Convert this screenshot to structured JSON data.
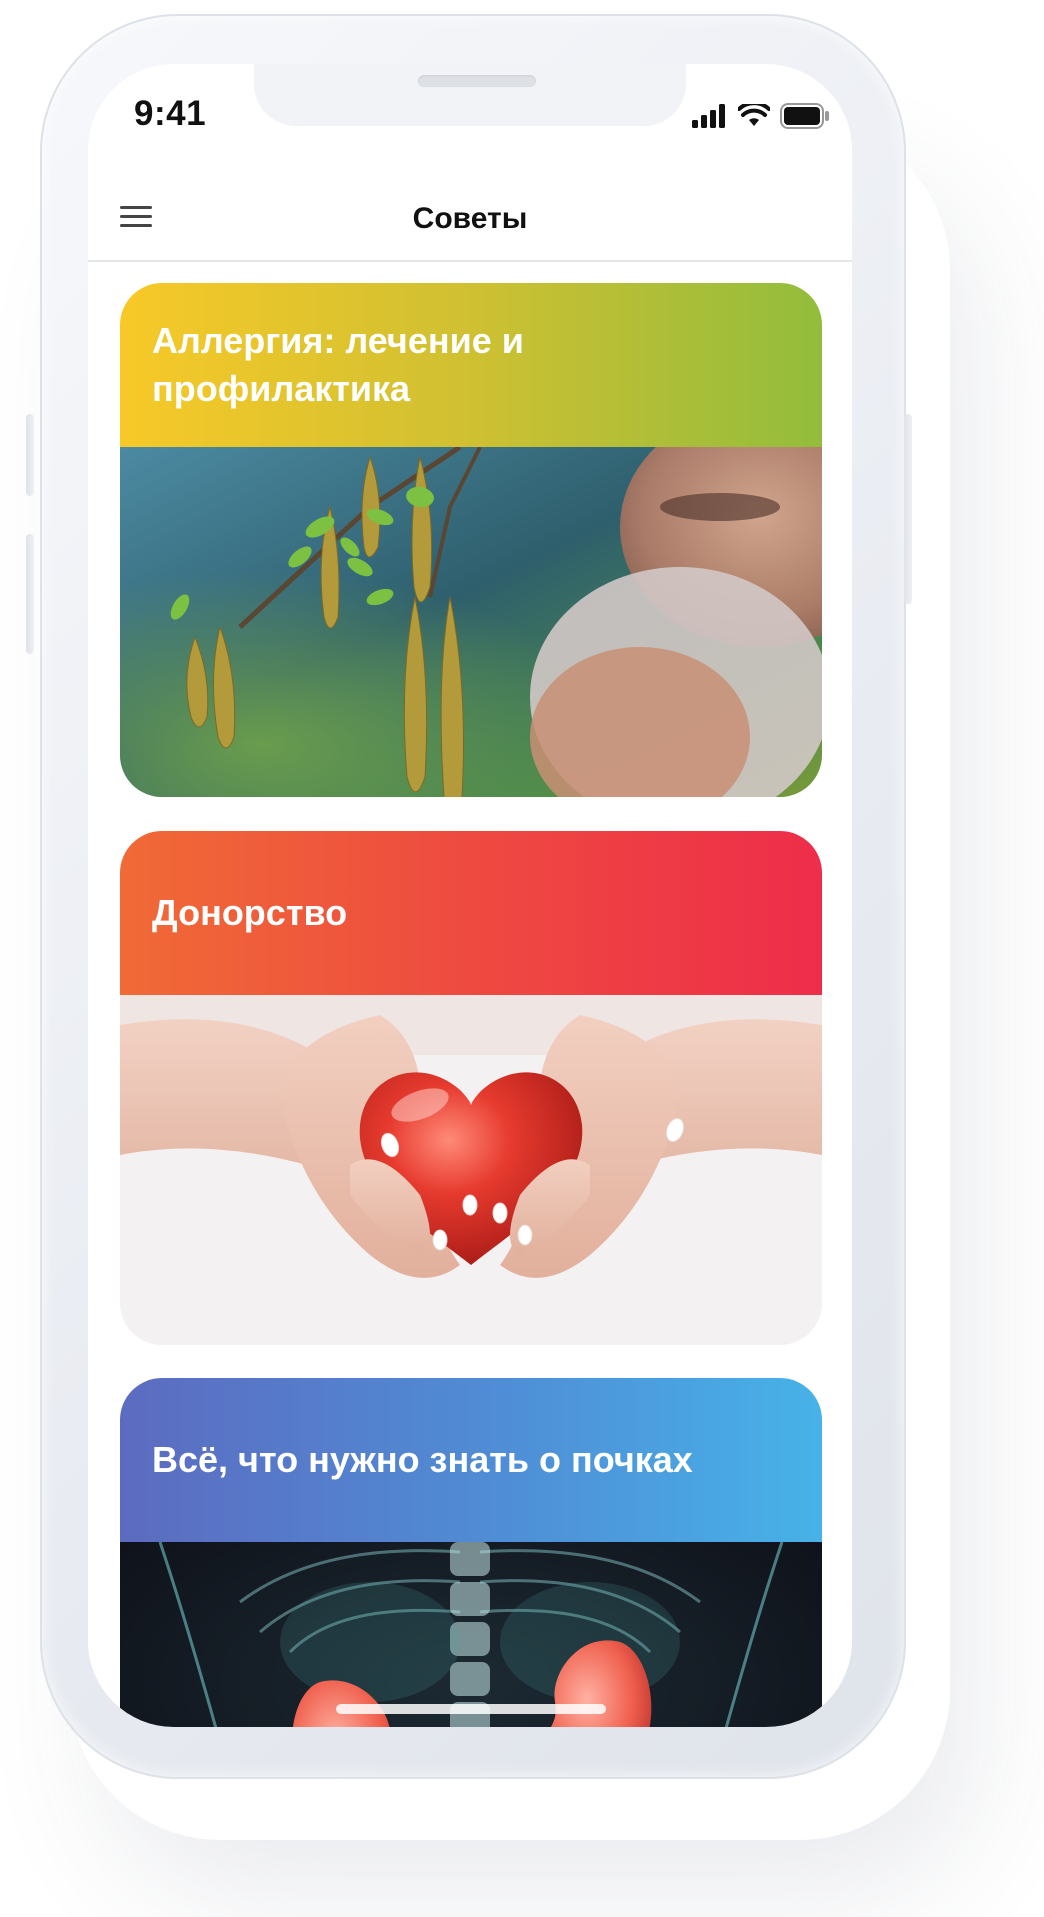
{
  "status_bar": {
    "time": "9:41"
  },
  "nav": {
    "title": "Советы",
    "menu_icon": "hamburger-menu-icon"
  },
  "cards": [
    {
      "title": "Аллергия: лечение и профилактика",
      "gradient": [
        "#f7c928",
        "#92bd3c"
      ],
      "image": "birch catkins and person sneezing"
    },
    {
      "title": "Донорство",
      "gradient": [
        "#f06a36",
        "#ee2d4a"
      ],
      "image": "hands holding red heart"
    },
    {
      "title": "Всё, что нужно знать о почках",
      "gradient": [
        "#5c6bc0",
        "#47b2e8"
      ],
      "image": "x-ray torso with kidneys"
    }
  ]
}
